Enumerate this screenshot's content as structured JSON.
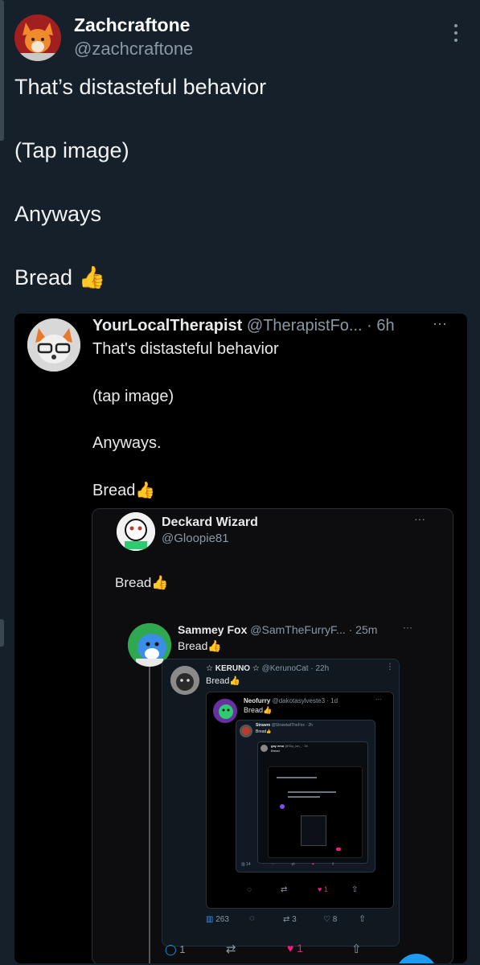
{
  "post": {
    "author_name": "Zachcraftone",
    "author_handle": "@zachcraftone",
    "lines": [
      "That’s distasteful behavior",
      "(Tap image)",
      "Anyways",
      "Bread"
    ],
    "bread_emoji": "👍"
  },
  "quote1": {
    "name": "YourLocalTherapist",
    "handle_time": "@TherapistFo... · 6h",
    "lines": [
      "That's distasteful behavior",
      "(tap image)",
      "Anyways.",
      "Bread"
    ],
    "emoji": "👍"
  },
  "quote2": {
    "name": "Deckard Wizard",
    "handle": "@Gloopie81",
    "text": "Bread",
    "emoji": "👍"
  },
  "quote3": {
    "name": "Sammey Fox",
    "handle_time": "@SamTheFurryF... · 25m",
    "text": "Bread",
    "emoji": "👍",
    "actions": {
      "replies": "1",
      "likes": "1"
    }
  },
  "quote4": {
    "name": "☆ KERUNO ☆",
    "handle_time": "@KerunoCat · 22h",
    "text": "Bread",
    "emoji": "👍",
    "actions": {
      "views": "263",
      "retweets": "3",
      "likes": "8"
    }
  },
  "quote5": {
    "name": "Neofurry",
    "handle_time": "@dakotasylveste3 · 1d",
    "text": "Bread",
    "emoji": "👍",
    "actions": {
      "likes": "1"
    }
  },
  "quote6": {
    "name": "Strawre",
    "handle_time": "@StrawtailTheFox · 2h",
    "text": "Bread",
    "emoji": "👍",
    "views": "14"
  },
  "quote7": {
    "name": "gay emo",
    "handle_time": "@Sky_lan_ · 3h",
    "text": "Bread"
  },
  "colors": {
    "background": "#15202b",
    "secondary_text": "#8b98a5",
    "like_pink": "#f91880",
    "accent_blue": "#1d9bf0"
  }
}
